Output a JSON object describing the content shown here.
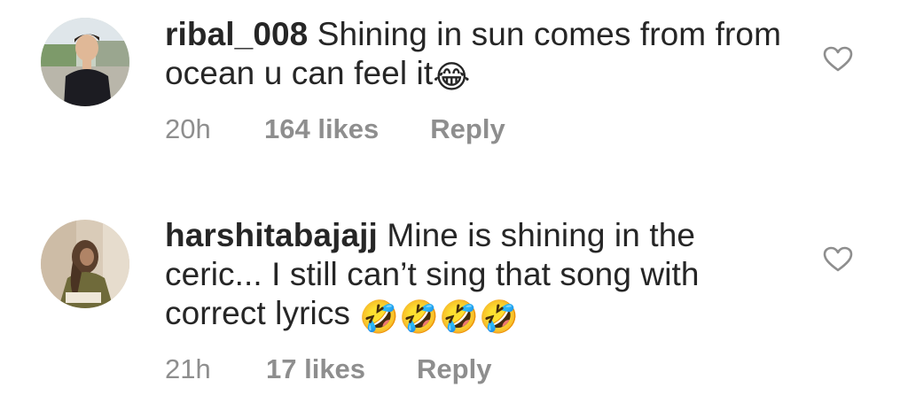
{
  "comments": [
    {
      "username": "ribal_008",
      "text": "Shining in sun comes from from ocean u can feel it",
      "emoji": "😂",
      "time": "20h",
      "likes": "164 likes",
      "reply_label": "Reply"
    },
    {
      "username": "harshitabajajj",
      "text": "Mine is shining in the ceric... I still can’t sing that song with correct lyrics",
      "emoji": "🤣🤣🤣🤣",
      "time": "21h",
      "likes": "17 likes",
      "reply_label": "Reply"
    }
  ],
  "icons": {
    "like": "heart-outline-icon"
  },
  "colors": {
    "text": "#262626",
    "meta": "#8e8e8e",
    "heart_stroke": "#8e8e8e"
  }
}
